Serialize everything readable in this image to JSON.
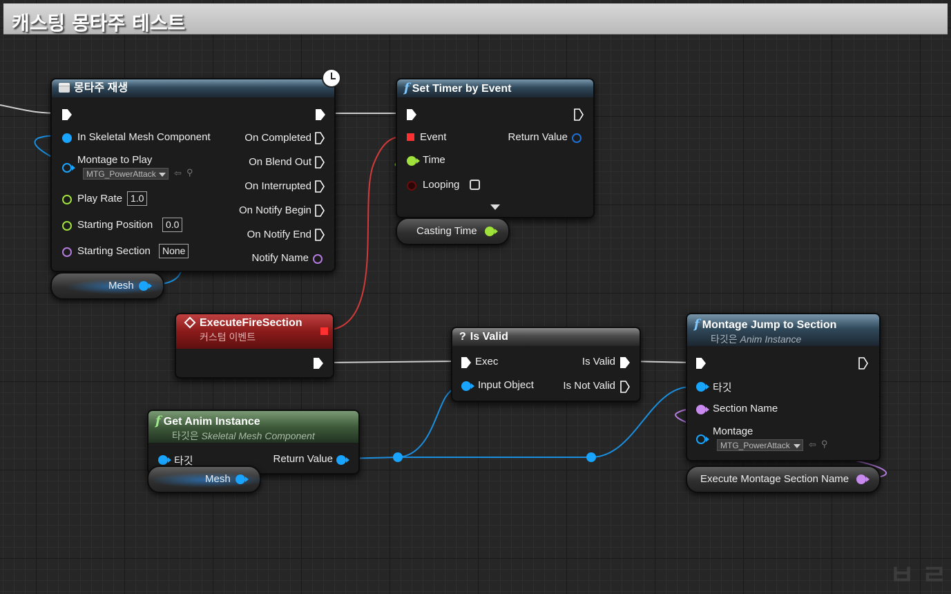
{
  "comment": {
    "title": "캐스팅 몽타주 테스트"
  },
  "play_montage": {
    "title": "몽타주 재생",
    "inputs": {
      "mesh_component": "In Skeletal Mesh Component",
      "montage_to_play": "Montage to Play",
      "montage_value": "MTG_PowerAttack",
      "play_rate": "Play Rate",
      "play_rate_value": "1.0",
      "starting_position": "Starting Position",
      "starting_position_value": "0.0",
      "starting_section": "Starting Section",
      "starting_section_value": "None"
    },
    "outputs": {
      "on_completed": "On Completed",
      "on_blend_out": "On Blend Out",
      "on_interrupted": "On Interrupted",
      "on_notify_begin": "On Notify Begin",
      "on_notify_end": "On Notify End",
      "notify_name": "Notify Name"
    }
  },
  "set_timer": {
    "title": "Set Timer by Event",
    "event": "Event",
    "time": "Time",
    "looping": "Looping",
    "return_value": "Return Value"
  },
  "casting_time_var": "Casting Time",
  "mesh_var_1": "Mesh",
  "custom_event": {
    "title": "ExecuteFireSection",
    "subtitle": "커스텀 이벤트"
  },
  "is_valid": {
    "title": "Is Valid",
    "exec": "Exec",
    "input_object": "Input Object",
    "is_valid": "Is Valid",
    "is_not_valid": "Is Not Valid"
  },
  "get_anim_instance": {
    "title": "Get Anim Instance",
    "subtitle_prefix": "타깃은 ",
    "subtitle_type": "Skeletal Mesh Component",
    "target": "타깃",
    "return_value": "Return Value"
  },
  "mesh_var_2": "Mesh",
  "montage_jump": {
    "title": "Montage Jump to Section",
    "subtitle_prefix": "타깃은 ",
    "subtitle_type": "Anim Instance",
    "target": "타깃",
    "section_name": "Section Name",
    "montage": "Montage",
    "montage_value": "MTG_PowerAttack"
  },
  "section_name_var": "Execute Montage Section Name",
  "colors": {
    "exec": "#ffffff",
    "object_pin": "#19a4ff",
    "float_pin": "#a0e23c",
    "name_pin": "#c98af0",
    "delegate_pin": "#ff3030",
    "boolean_pin": "#6a0d0d"
  }
}
